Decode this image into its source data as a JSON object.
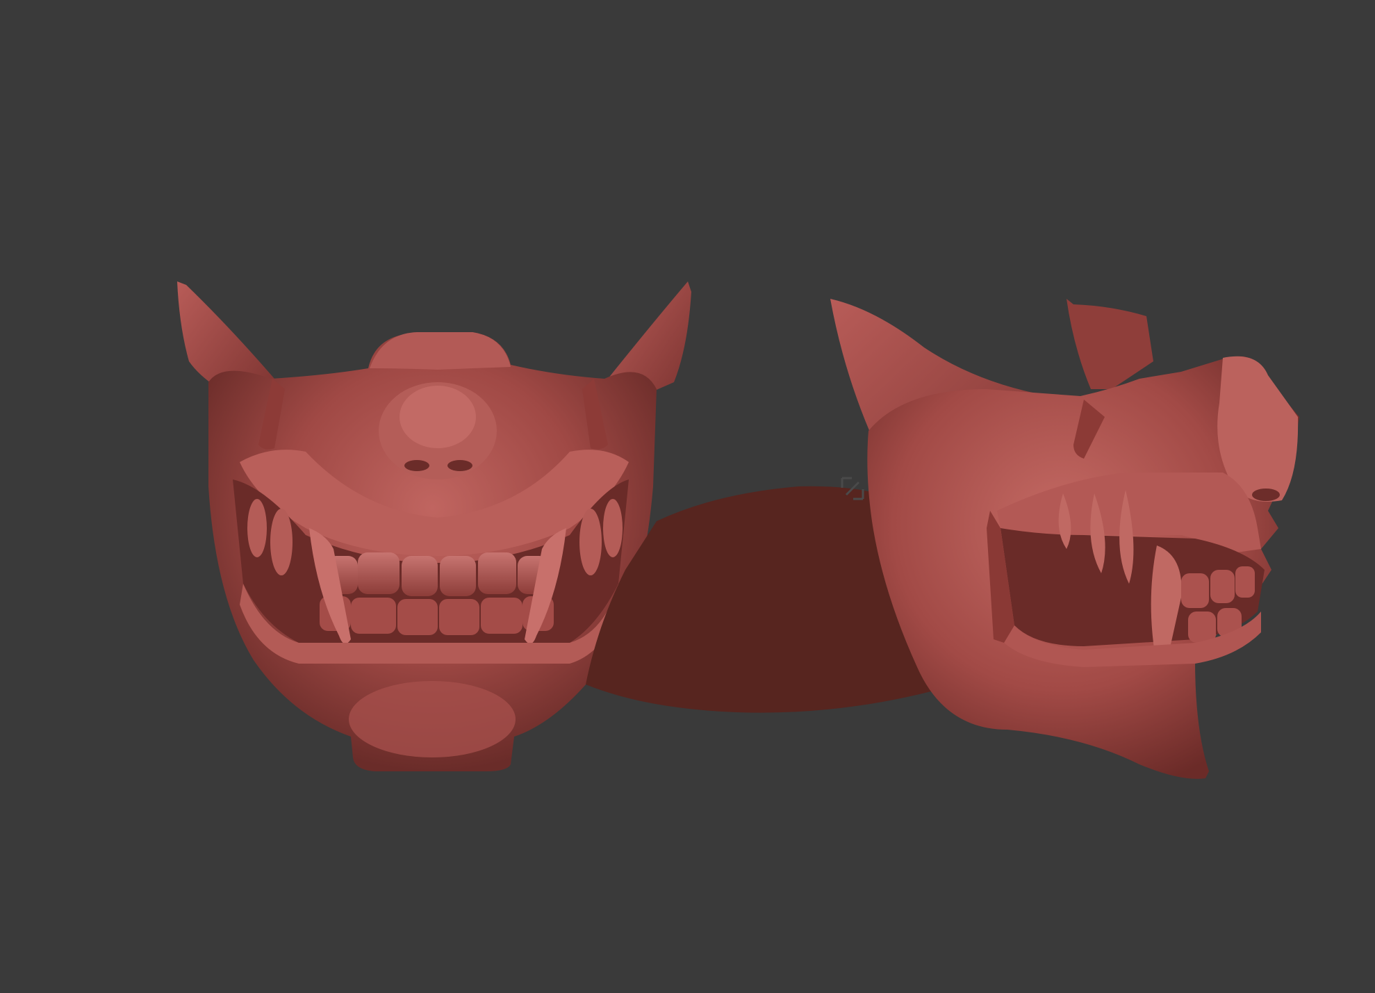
{
  "viewport": {
    "background": "#3a3a3a",
    "clay_color": "#a9504c",
    "clay_dark": "#5e2624",
    "clay_shadow": "#3e1b1a",
    "partial_mesh_color": "#57251f"
  },
  "objects": [
    {
      "name": "oni-mask-front-view",
      "icon": "mask"
    },
    {
      "name": "partial-mesh-fragment",
      "icon": "mesh"
    },
    {
      "name": "oni-mask-side-view",
      "icon": "mask"
    }
  ],
  "overlay": {
    "icon": "frame-corner-icon"
  }
}
